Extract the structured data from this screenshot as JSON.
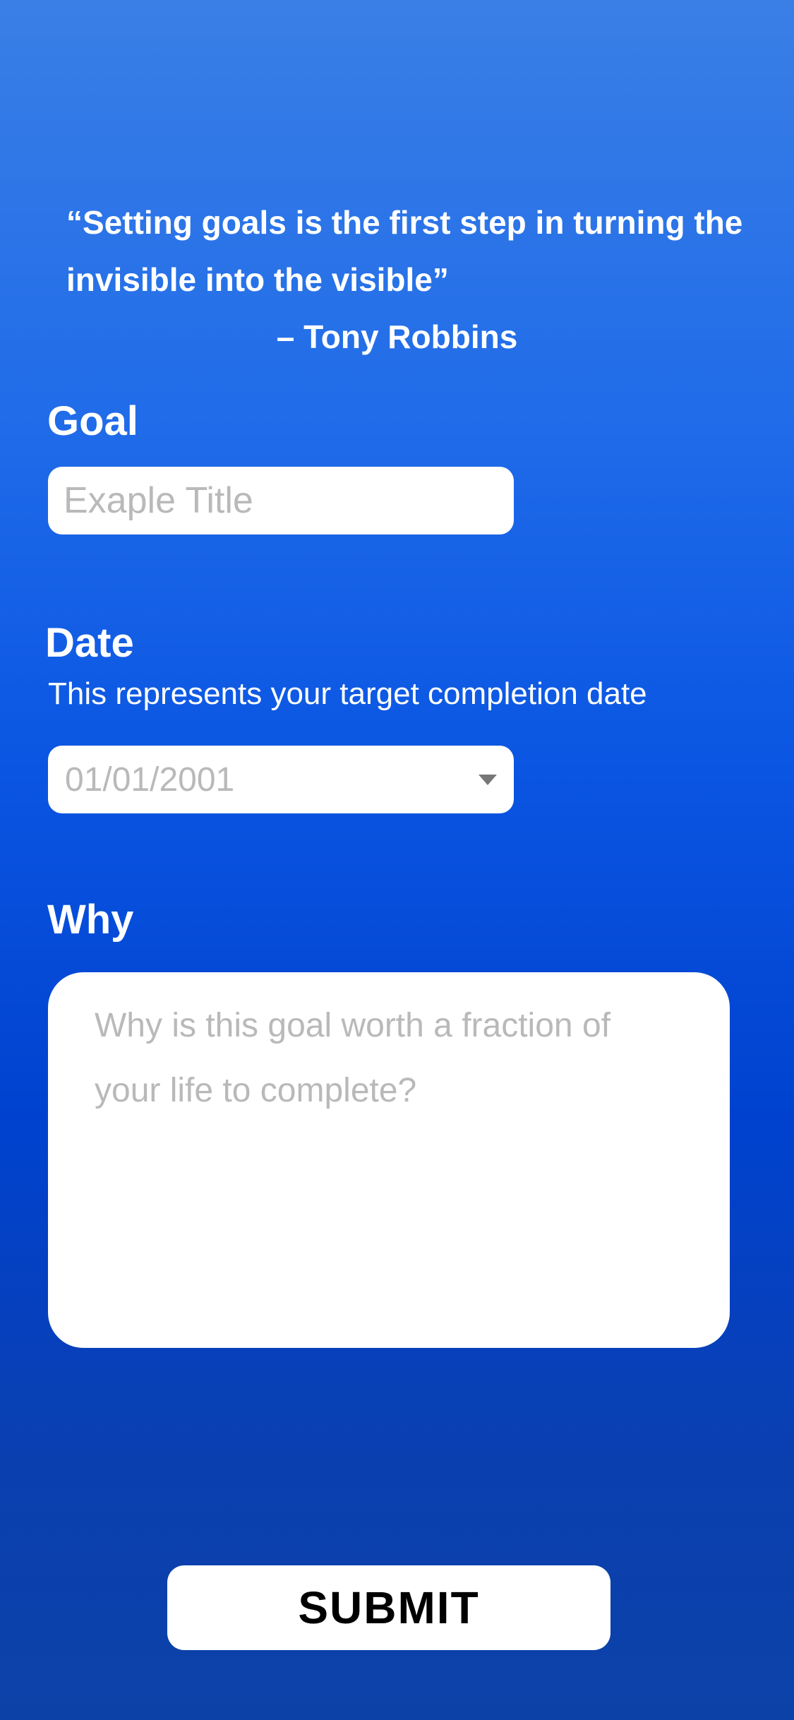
{
  "quote": {
    "text": "“Setting goals is the first step in turning the invisible into the visible”",
    "author": "– Tony Robbins"
  },
  "goal": {
    "label": "Goal",
    "placeholder": "Exaple Title"
  },
  "date": {
    "label": "Date",
    "description": "This represents your target completion date",
    "value": "01/01/2001",
    "caret_icon": "caret-down-icon"
  },
  "why": {
    "label": "Why",
    "placeholder": "Why is this goal worth a fraction of your life to complete?"
  },
  "submit": {
    "label": "SUBMIT"
  },
  "colors": {
    "background_top": "#3a7fe6",
    "background_bottom": "#0c42a8",
    "field_background": "#ffffff",
    "placeholder": "#b9b9b9"
  }
}
